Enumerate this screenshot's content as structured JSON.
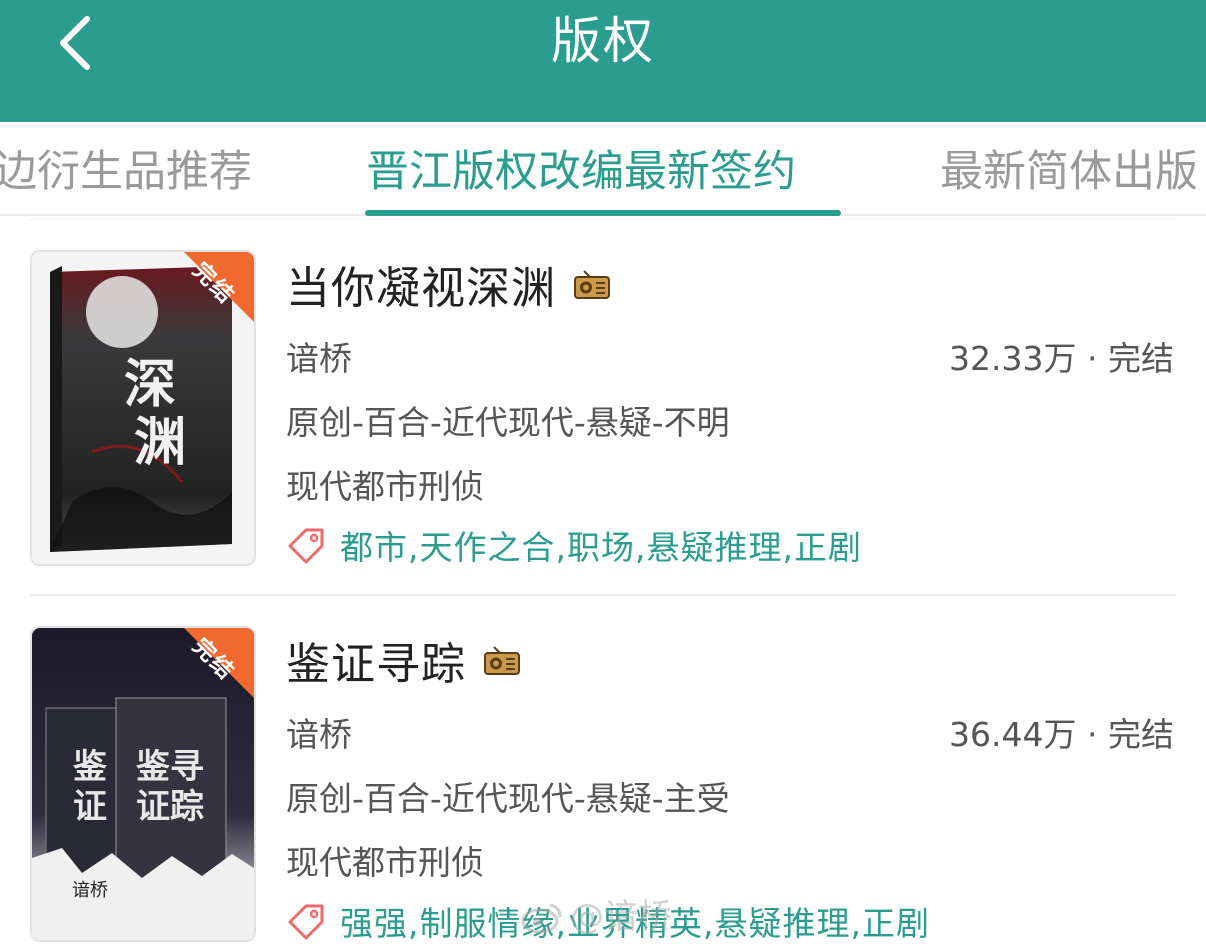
{
  "header": {
    "title": "版权",
    "bg_color": "#2a9d8f"
  },
  "tabs": [
    {
      "label": "边衍生品推荐",
      "active": false
    },
    {
      "label": "晋江版权改编最新签约",
      "active": true
    },
    {
      "label": "最新简体出版",
      "active": false
    }
  ],
  "books": [
    {
      "badge": "完结",
      "title": "当你凝视深渊",
      "icon": "radio-icon",
      "author": "谙桥",
      "stats": "32.33万 · 完结",
      "genre": "原创-百合-近代现代-悬疑-不明",
      "era": "现代都市刑侦",
      "tags": "都市,天作之合,职场,悬疑推理,正剧"
    },
    {
      "badge": "完结",
      "title": "鉴证寻踪",
      "icon": "radio-icon",
      "author": "谙桥",
      "stats": "36.44万 · 完结",
      "genre": "原创-百合-近代现代-悬疑-主受",
      "era": "现代都市刑侦",
      "tags": "强强,制服情缘,业界精英,悬疑推理,正剧"
    }
  ],
  "watermark": "@谙桥",
  "colors": {
    "accent": "#2a9d8f",
    "badge": "#f0692f",
    "tag_icon": "#f06a6a"
  }
}
